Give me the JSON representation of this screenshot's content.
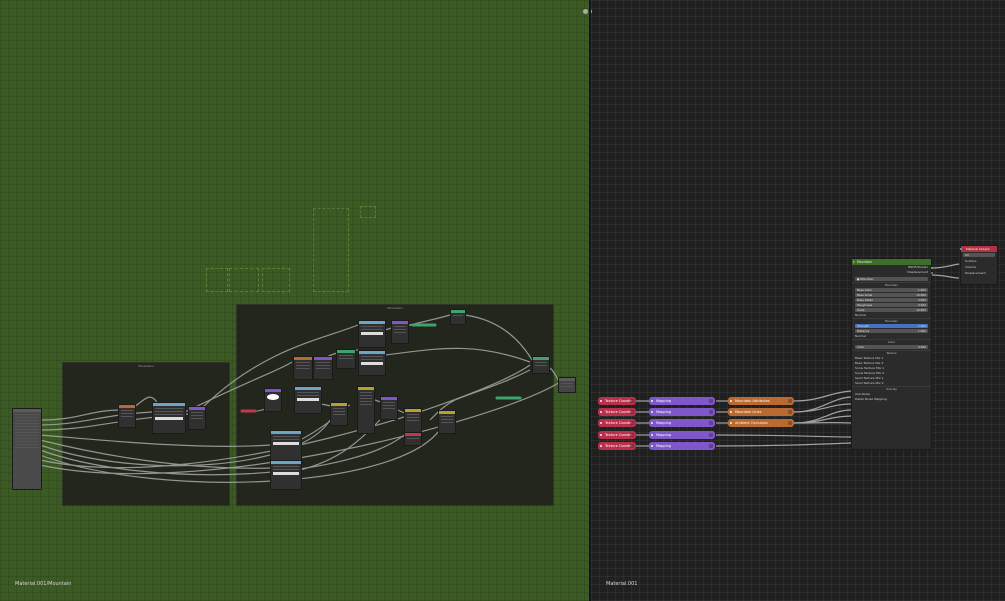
{
  "left_editor": {
    "path": "Material.001/Mountain",
    "frames": [
      {
        "label": "Mountains"
      },
      {
        "label": "Mountains"
      }
    ]
  },
  "right_editor": {
    "path": "Material.001",
    "texture_nodes": [
      {
        "label": "Texture Coordin"
      },
      {
        "label": "Texture Coordin"
      },
      {
        "label": "Texture Coordin"
      },
      {
        "label": "Texture Coordin"
      },
      {
        "label": "Texture Coordin"
      }
    ],
    "mapping_nodes": [
      {
        "label": "Mapping"
      },
      {
        "label": "Mapping"
      },
      {
        "label": "Mapping"
      },
      {
        "label": "Mapping"
      },
      {
        "label": "Mapping"
      }
    ],
    "attribute_nodes": [
      {
        "label": "Mountain Attributes"
      },
      {
        "label": "Mountain Lines"
      },
      {
        "label": "Ambient Occlusion"
      }
    ],
    "group_node": {
      "title": "Mountain",
      "outputs": [
        "BSDF/Shader",
        "Displacement"
      ],
      "datablock": "Mountain",
      "sections": {
        "mountain": "Mountain",
        "blend": "Mountain",
        "color": "Color",
        "texture": "Texture",
        "overlay": "Overlay"
      },
      "fields": [
        {
          "label": "Base Color",
          "value": "1.000"
        },
        {
          "label": "Base Scale",
          "value": "10.000"
        },
        {
          "label": "Base Detail",
          "value": "2.000"
        },
        {
          "label": "Roughness",
          "value": "0.500"
        },
        {
          "label": "Scale",
          "value": "10.000"
        }
      ],
      "normal_label": "Normal",
      "blend_fields": [
        {
          "label": "Strength",
          "value": "1.000",
          "active": true
        },
        {
          "label": "Distance",
          "value": "1.000",
          "active": false
        }
      ],
      "blend_normal": "Normal",
      "color_field": {
        "label": "Color",
        "value": "0.500"
      },
      "texture_rows": [
        "Base Texture Mix 1",
        "Base Texture Mix 2",
        "Snow Texture Mix 1",
        "Snow Texture Mix 2",
        "Sand Texture Mix 1",
        "Sand Texture Mix 2"
      ],
      "overlay_rows": [
        "Use Noise",
        "Detail Noise Mapping"
      ]
    },
    "output_node": {
      "title": "Material Output",
      "target": "All",
      "rows": [
        "Surface",
        "Volume",
        "Displacement"
      ]
    }
  },
  "colors": {
    "left_background": "#3c5a24",
    "right_background": "#202020",
    "texture_node": "#b8304a",
    "mapping_node": "#7f57c9",
    "attribute_node": "#b86a30",
    "group_header": "#3f6d2a",
    "output_header": "#b03344"
  },
  "icons": [
    "material-sphere-icon",
    "collapse-icon"
  ]
}
